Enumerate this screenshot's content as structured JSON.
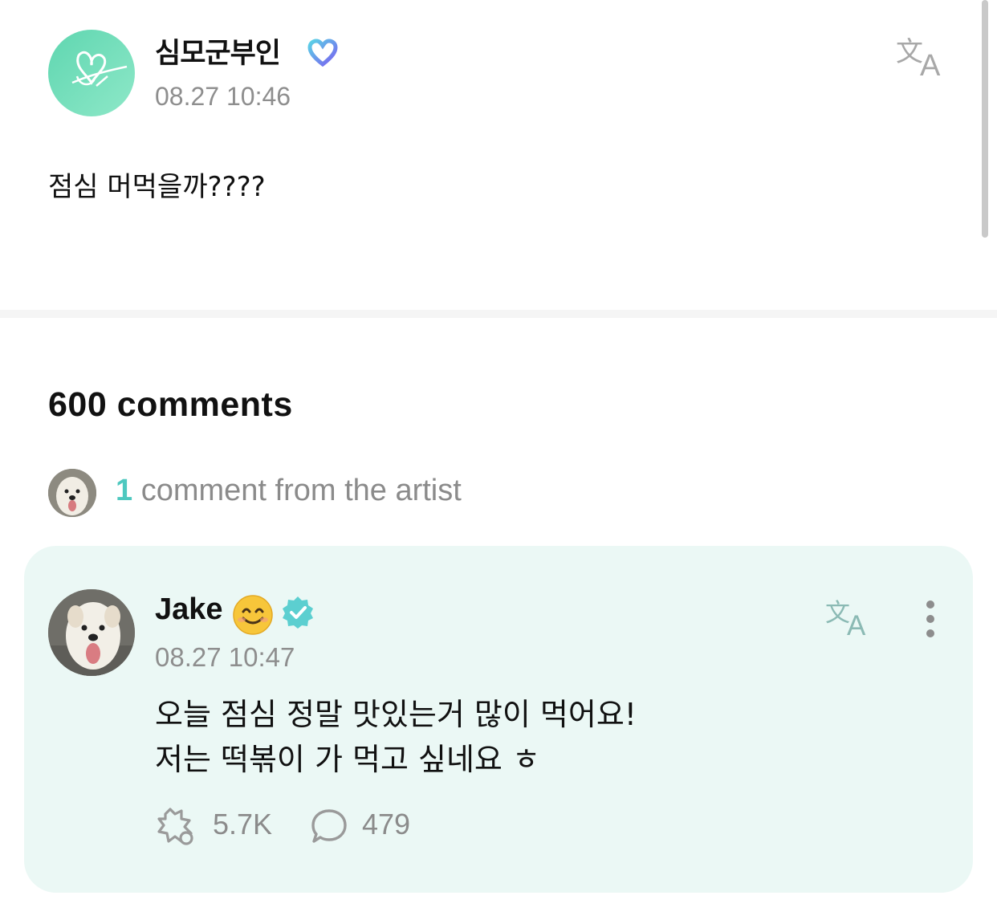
{
  "post": {
    "author": "심모군부인",
    "time": "08.27 10:46",
    "body": "점심 머먹을까????"
  },
  "comments": {
    "count_label": "600 comments",
    "artist_count": "1",
    "artist_label": " comment from the artist"
  },
  "artist_comment": {
    "author": "Jake",
    "time": "08.27 10:47",
    "line1": "오늘 점심 정말 맛있는거 많이 먹어요!",
    "line2": "저는 떡볶이 가 먹고 싶네요 ㅎ",
    "likes": "5.7K",
    "replies": "479"
  },
  "colors": {
    "accent": "#4ec8bf",
    "card_bg": "#ebf8f5",
    "muted_text": "#8e8e8e"
  },
  "icons": [
    "verified-heart-icon",
    "translate-icon",
    "verified-check-icon",
    "smile-emoji-icon",
    "more-icon",
    "like-icon",
    "reply-icon"
  ]
}
